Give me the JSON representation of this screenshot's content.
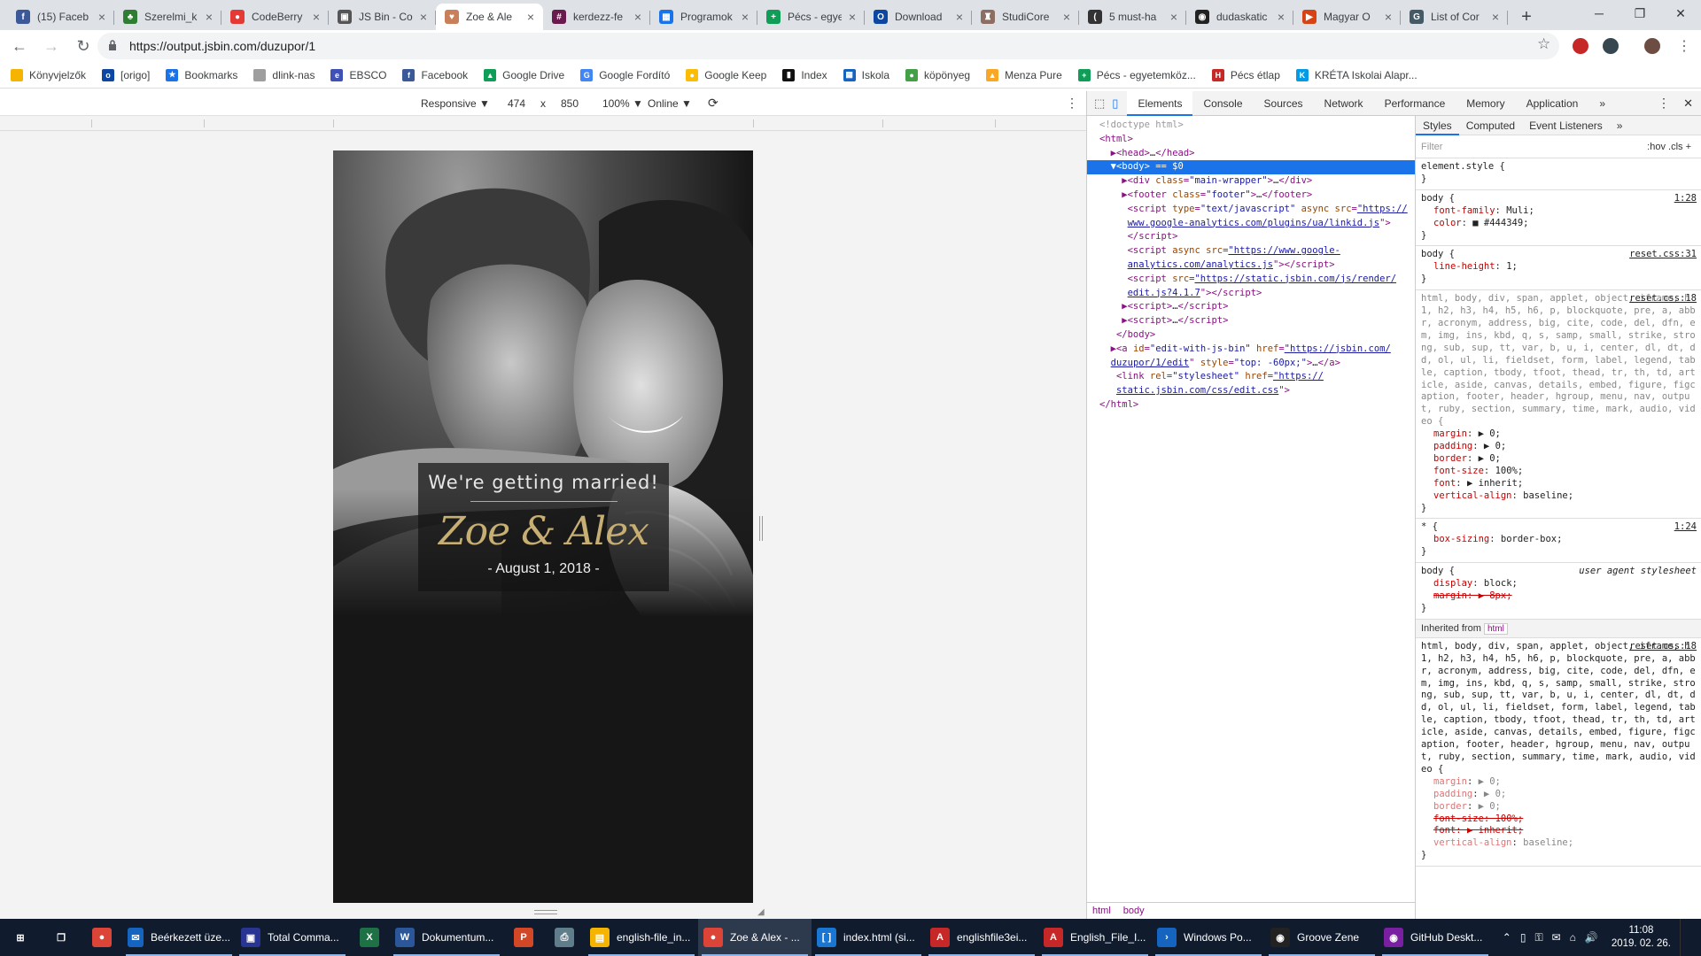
{
  "tabs": [
    {
      "title": "(15) Faceb",
      "icon": "facebook-icon",
      "color": "#3b5998",
      "glyph": "f"
    },
    {
      "title": "Szerelmi_k",
      "icon": "leaf-icon",
      "color": "#2e7d32",
      "glyph": "♣"
    },
    {
      "title": "CodeBerry",
      "icon": "codeberry-icon",
      "color": "#e53935",
      "glyph": "●"
    },
    {
      "title": "JS Bin - Co",
      "icon": "jsbin-icon",
      "color": "#555555",
      "glyph": "▣"
    },
    {
      "title": "Zoe & Ale",
      "icon": "heart-icon",
      "color": "#c87f5a",
      "glyph": "♥"
    },
    {
      "title": "kerdezz-fe",
      "icon": "slack-icon",
      "color": "#6a1b4d",
      "glyph": "#"
    },
    {
      "title": "Programok",
      "icon": "sheets-icon",
      "color": "#1a73e8",
      "glyph": "▦"
    },
    {
      "title": "Pécs - egye",
      "icon": "green-plus-icon",
      "color": "#0f9d58",
      "glyph": "+"
    },
    {
      "title": "Download",
      "icon": "outlook-icon",
      "color": "#0d47a1",
      "glyph": "O"
    },
    {
      "title": "StudiCore",
      "icon": "studicore-icon",
      "color": "#8d6e63",
      "glyph": "♜"
    },
    {
      "title": "5 must-ha",
      "icon": "medium-icon",
      "color": "#333333",
      "glyph": "("
    },
    {
      "title": "dudaskatic",
      "icon": "github-icon",
      "color": "#222222",
      "glyph": "◉"
    },
    {
      "title": "Magyar O",
      "icon": "flag-icon",
      "color": "#d84315",
      "glyph": "▶"
    },
    {
      "title": "List of Cor",
      "icon": "doc-icon",
      "color": "#455a64",
      "glyph": "G"
    }
  ],
  "active_tab_index": 4,
  "window_controls": {
    "minimize": "─",
    "restore": "❐",
    "close": "✕"
  },
  "nav": {
    "back": "←",
    "forward": "→",
    "reload": "↻"
  },
  "address_bar": {
    "url": "https://output.jsbin.com/duzupor/1",
    "lock": "🔒"
  },
  "bookmarks": [
    {
      "label": "Könyvjelzők",
      "icon": "folder-icon",
      "color": "#f4b400",
      "glyph": ""
    },
    {
      "label": "[origo]",
      "icon": "origo-icon",
      "color": "#0d47a1",
      "glyph": "o"
    },
    {
      "label": "Bookmarks",
      "icon": "star-icon",
      "color": "#1a73e8",
      "glyph": "★"
    },
    {
      "label": "dlink-nas",
      "icon": "page-icon",
      "color": "#9e9e9e",
      "glyph": ""
    },
    {
      "label": "EBSCO",
      "icon": "ebsco-icon",
      "color": "#3f51b5",
      "glyph": "e"
    },
    {
      "label": "Facebook",
      "icon": "facebook-icon",
      "color": "#3b5998",
      "glyph": "f"
    },
    {
      "label": "Google Drive",
      "icon": "drive-icon",
      "color": "#0f9d58",
      "glyph": "▲"
    },
    {
      "label": "Google Fordító",
      "icon": "translate-icon",
      "color": "#4285f4",
      "glyph": "G"
    },
    {
      "label": "Google Keep",
      "icon": "keep-icon",
      "color": "#fbbc04",
      "glyph": "●"
    },
    {
      "label": "Index",
      "icon": "index-icon",
      "color": "#111111",
      "glyph": "▮"
    },
    {
      "label": "Iskola",
      "icon": "grid-icon",
      "color": "#1565c0",
      "glyph": "▦"
    },
    {
      "label": "köpönyeg",
      "icon": "frog-icon",
      "color": "#43a047",
      "glyph": "●"
    },
    {
      "label": "Menza Pure",
      "icon": "menza-icon",
      "color": "#f9a825",
      "glyph": "▲"
    },
    {
      "label": "Pécs - egyetemköz...",
      "icon": "green-plus-icon",
      "color": "#0f9d58",
      "glyph": "+"
    },
    {
      "label": "Pécs étlap",
      "icon": "etlap-icon",
      "color": "#c62828",
      "glyph": "H"
    },
    {
      "label": "KRÉTA Iskolai Alapr...",
      "icon": "kreta-icon",
      "color": "#039be5",
      "glyph": "K"
    }
  ],
  "device_toolbar": {
    "mode": "Responsive ▼",
    "width": "474",
    "times": "x",
    "height": "850",
    "zoom": "100% ▼",
    "network": "Online ▼",
    "rotate": "⟳",
    "more": "⋮"
  },
  "wedding": {
    "headline": "We're getting married!",
    "names": "Zoe & Alex",
    "date": "- August 1, 2018 -"
  },
  "devtools": {
    "tabs": [
      "Elements",
      "Console",
      "Sources",
      "Network",
      "Performance",
      "Memory",
      "Application",
      "»"
    ],
    "active_tab": "Elements",
    "more": "⋮",
    "close": "✕",
    "breadcrumbs": [
      "html",
      "body"
    ],
    "styles_tabs": [
      "Styles",
      "Computed",
      "Event Listeners",
      "»"
    ],
    "filter_placeholder": "Filter",
    "filter_tools": ":hov  .cls  +",
    "inherited_label": "Inherited from",
    "inherited_tag": "html"
  },
  "taskbar": {
    "apps": [
      {
        "label": "",
        "icon": "windows-start-icon",
        "color": "#101c2e",
        "glyph": "⊞"
      },
      {
        "label": "",
        "icon": "task-view-icon",
        "color": "#101c2e",
        "glyph": "❐"
      },
      {
        "label": "",
        "icon": "chrome-icon",
        "color": "#db4437",
        "glyph": "●"
      },
      {
        "label": "Beérkezett üze...",
        "icon": "thunderbird-icon",
        "color": "#1565c0",
        "glyph": "✉"
      },
      {
        "label": "Total Comma...",
        "icon": "floppy-icon",
        "color": "#283593",
        "glyph": "▣"
      },
      {
        "label": "",
        "icon": "excel-icon",
        "color": "#1e7145",
        "glyph": "X"
      },
      {
        "label": "Dokumentum...",
        "icon": "word-icon",
        "color": "#2b579a",
        "glyph": "W"
      },
      {
        "label": "",
        "icon": "powerpoint-icon",
        "color": "#d24726",
        "glyph": "P"
      },
      {
        "label": "",
        "icon": "printer-icon",
        "color": "#607d8b",
        "glyph": "⎙"
      },
      {
        "label": "english-file_in...",
        "icon": "folder-icon",
        "color": "#f4b400",
        "glyph": "▤"
      },
      {
        "label": "Zoe & Alex - ...",
        "icon": "chrome-icon",
        "color": "#db4437",
        "glyph": "●"
      },
      {
        "label": "index.html (si...",
        "icon": "brackets-icon",
        "color": "#1976d2",
        "glyph": "[ ]"
      },
      {
        "label": "englishfile3ei...",
        "icon": "pdf-icon",
        "color": "#c62828",
        "glyph": "A"
      },
      {
        "label": "English_File_I...",
        "icon": "pdf-icon",
        "color": "#c62828",
        "glyph": "A"
      },
      {
        "label": "Windows Po...",
        "icon": "powershell-icon",
        "color": "#1565c0",
        "glyph": "›"
      },
      {
        "label": "Groove Zene",
        "icon": "groove-icon",
        "color": "#222222",
        "glyph": "◉"
      },
      {
        "label": "GitHub Deskt...",
        "icon": "github-desktop-icon",
        "color": "#7b1fa2",
        "glyph": "◉"
      }
    ],
    "tray": [
      "⌃",
      "▯",
      "⚿",
      "✉",
      "⌂",
      "🔊"
    ],
    "time": "11:08",
    "date": "2019. 02. 26."
  }
}
